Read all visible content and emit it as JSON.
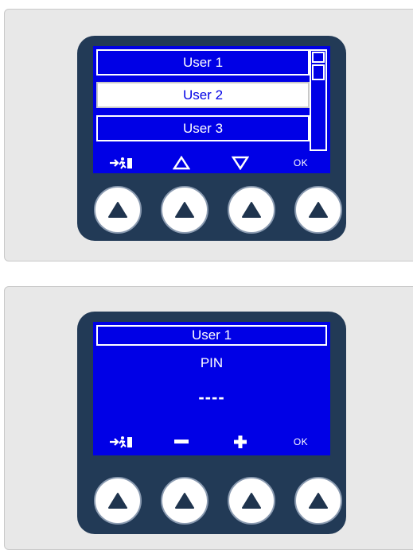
{
  "panel1": {
    "users": [
      "User 1",
      "User 2",
      "User 3"
    ],
    "selected_index": 1,
    "softkeys": {
      "exit_icon": "exit-icon",
      "up_icon": "up-triangle-icon",
      "down_icon": "down-triangle-icon",
      "ok_label": "OK"
    }
  },
  "panel2": {
    "header": "User 1",
    "label": "PIN",
    "value": "----",
    "softkeys": {
      "exit_icon": "exit-icon",
      "minus_icon": "minus-icon",
      "plus_icon": "plus-icon",
      "ok_label": "OK"
    }
  },
  "hardware_button_icon": "up-arrow-icon",
  "colors": {
    "screen": "#0000e6",
    "bezel": "#223a56",
    "panel": "#e8e8e8"
  }
}
